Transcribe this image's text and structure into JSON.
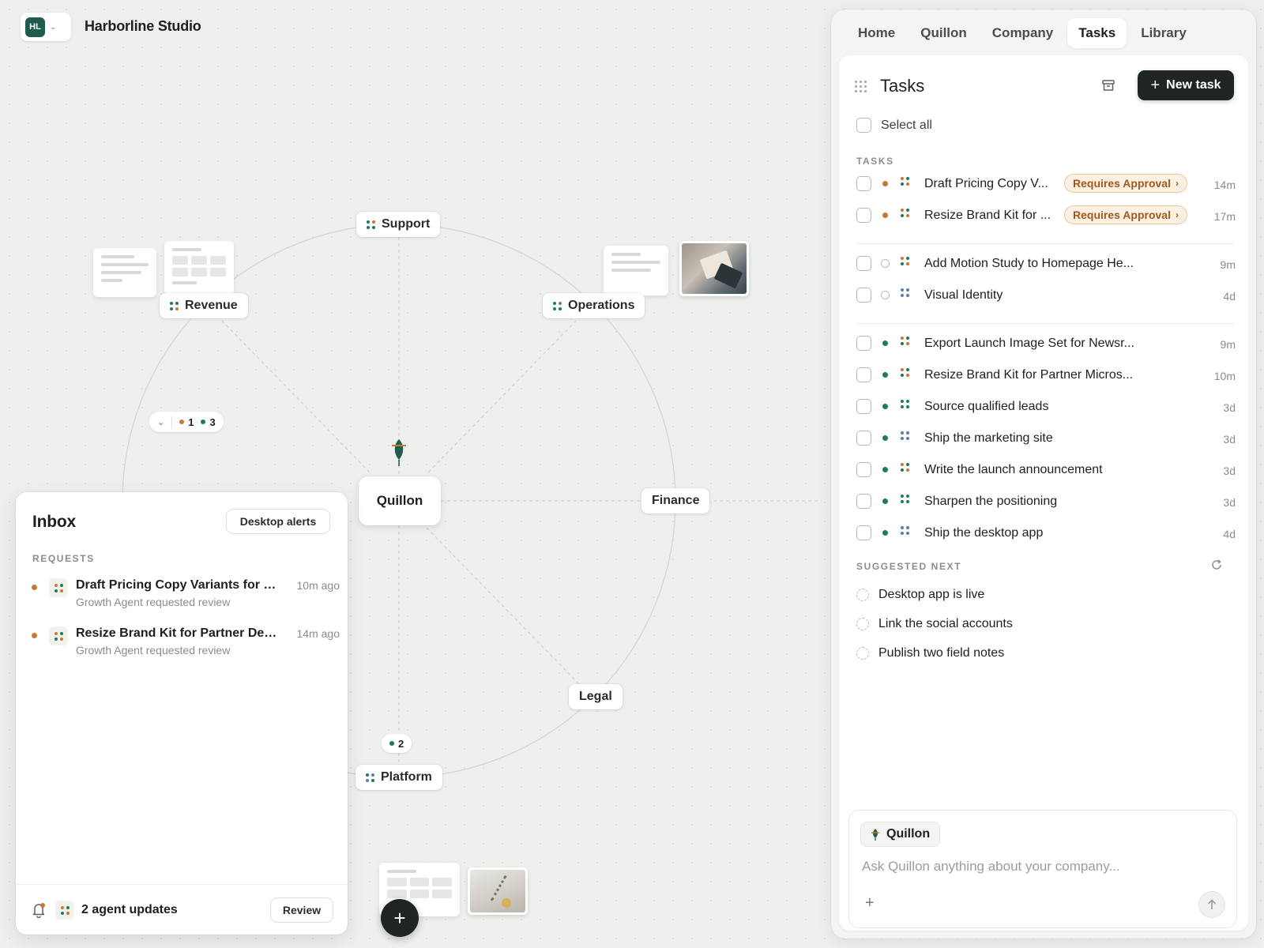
{
  "brand": {
    "logo_text": "HL",
    "name": "Harborline Studio"
  },
  "canvas": {
    "center_node": "Quillon",
    "nodes": {
      "support": "Support",
      "revenue": "Revenue",
      "operations": "Operations",
      "finance": "Finance",
      "legal": "Legal",
      "platform": "Platform"
    },
    "revenue_counter": {
      "orange": "1",
      "green": "3"
    },
    "platform_counter": {
      "green": "2"
    }
  },
  "inbox": {
    "title": "Inbox",
    "desktop_alerts_label": "Desktop alerts",
    "section_label": "REQUESTS",
    "items": [
      {
        "title": "Draft Pricing Copy Variants for Partner Launch",
        "subtitle": "Growth Agent requested review",
        "time": "10m ago"
      },
      {
        "title": "Resize Brand Kit for Partner Deck",
        "subtitle": "Growth Agent requested review",
        "time": "14m ago"
      }
    ],
    "footer": {
      "updates": "2 agent updates",
      "review_label": "Review"
    }
  },
  "tabs": [
    {
      "label": "Home"
    },
    {
      "label": "Quillon"
    },
    {
      "label": "Company"
    },
    {
      "label": "Tasks",
      "active": true
    },
    {
      "label": "Library"
    }
  ],
  "tasks": {
    "title": "Tasks",
    "new_task_label": "New task",
    "select_all_label": "Select all",
    "section_label": "TASKS",
    "approval_items": [
      {
        "title": "Draft Pricing Copy V...",
        "badge": "Requires Approval",
        "time": "14m"
      },
      {
        "title": "Resize Brand Kit for ...",
        "badge": "Requires Approval",
        "time": "17m"
      }
    ],
    "pending_items": [
      {
        "title": "Add Motion Study to Homepage He...",
        "time": "9m"
      },
      {
        "title": "Visual Identity",
        "time": "4d"
      }
    ],
    "active_items": [
      {
        "title": "Export Launch Image Set for Newsr...",
        "time": "9m"
      },
      {
        "title": "Resize Brand Kit for Partner Micros...",
        "time": "10m"
      },
      {
        "title": "Source qualified leads",
        "time": "3d"
      },
      {
        "title": "Ship the marketing site",
        "time": "3d"
      },
      {
        "title": "Write the launch announcement",
        "time": "3d"
      },
      {
        "title": "Sharpen the positioning",
        "time": "3d"
      },
      {
        "title": "Ship the desktop app",
        "time": "4d"
      }
    ],
    "suggested_label": "SUGGESTED NEXT",
    "suggested": [
      {
        "title": "Desktop app is live"
      },
      {
        "title": "Link the social accounts"
      },
      {
        "title": "Publish two field notes"
      }
    ]
  },
  "composer": {
    "agent_label": "Quillon",
    "placeholder": "Ask Quillon anything about your company..."
  },
  "colors": {
    "accent_dark": "#1e2523",
    "brand_green": "#1f5c4f",
    "status_orange": "#c57a32",
    "status_green": "#1f7a5c",
    "badge_text": "#a1591c"
  }
}
